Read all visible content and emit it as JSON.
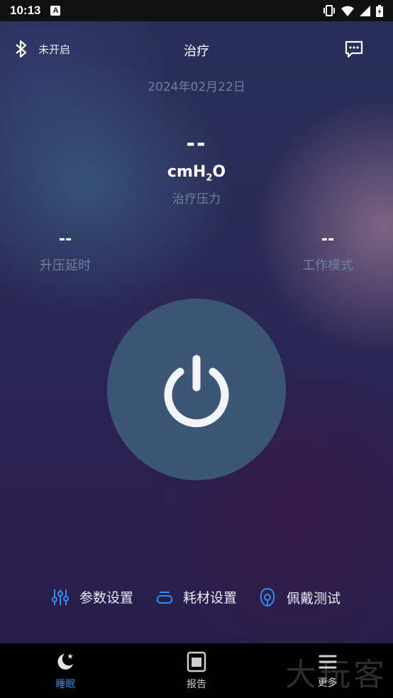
{
  "status_bar": {
    "time": "10:13",
    "notification_letter": "A"
  },
  "header": {
    "bluetooth_status": "未开启",
    "title": "治疗"
  },
  "date": "2024年02月22日",
  "pressure": {
    "value": "--",
    "unit_prefix": "cmH",
    "unit_sub": "2",
    "unit_suffix": "O",
    "label": "治疗压力"
  },
  "stats": {
    "left": {
      "value": "--",
      "label": "升压延时"
    },
    "right": {
      "value": "--",
      "label": "工作模式"
    }
  },
  "actions": [
    {
      "label": "参数设置",
      "icon": "sliders-icon"
    },
    {
      "label": "耗材设置",
      "icon": "consumable-icon"
    },
    {
      "label": "佩戴测试",
      "icon": "mask-icon"
    }
  ],
  "nav": [
    {
      "label": "睡眠",
      "icon": "moon-icon",
      "active": true
    },
    {
      "label": "报告",
      "icon": "report-icon",
      "active": false
    },
    {
      "label": "更多",
      "icon": "menu-icon",
      "active": false
    }
  ],
  "watermark": "大玩客",
  "colors": {
    "accent": "#2f8ef0",
    "power_button": "#3e5676",
    "muted_text": "#6d7fa3"
  }
}
